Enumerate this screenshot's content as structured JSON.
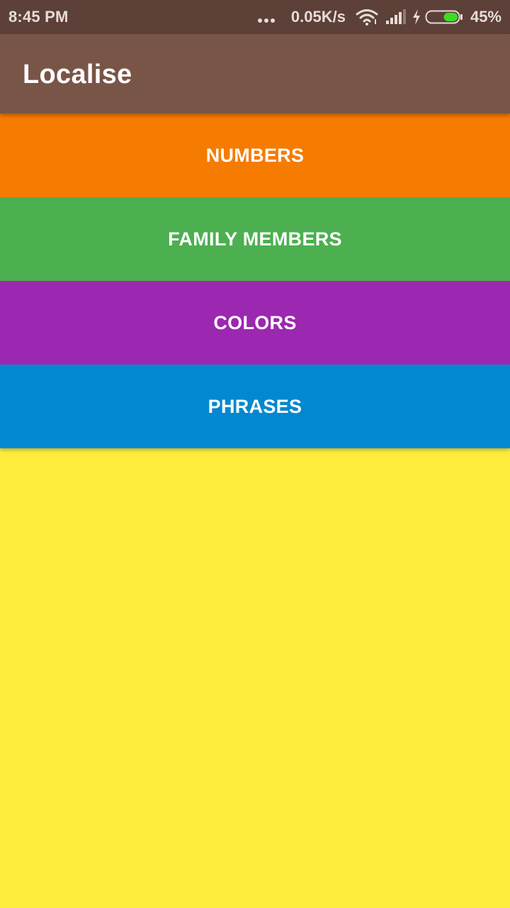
{
  "status_bar": {
    "time": "8:45 PM",
    "network_speed": "0.05K/s",
    "battery_percent": "45%",
    "battery_level": 0.45,
    "icons": [
      "more-dots-icon",
      "wifi-icon",
      "signal-icon",
      "charging-bolt-icon",
      "battery-icon"
    ]
  },
  "app_bar": {
    "title": "Localise"
  },
  "categories": [
    {
      "label": "NUMBERS",
      "color": "#F57C00"
    },
    {
      "label": "FAMILY MEMBERS",
      "color": "#4CAF50"
    },
    {
      "label": "COLORS",
      "color": "#9C27B0"
    },
    {
      "label": "PHRASES",
      "color": "#0288D1"
    }
  ],
  "colors": {
    "status_bar": "#5D4037",
    "app_bar": "#795548",
    "background": "#FFEB3B"
  }
}
